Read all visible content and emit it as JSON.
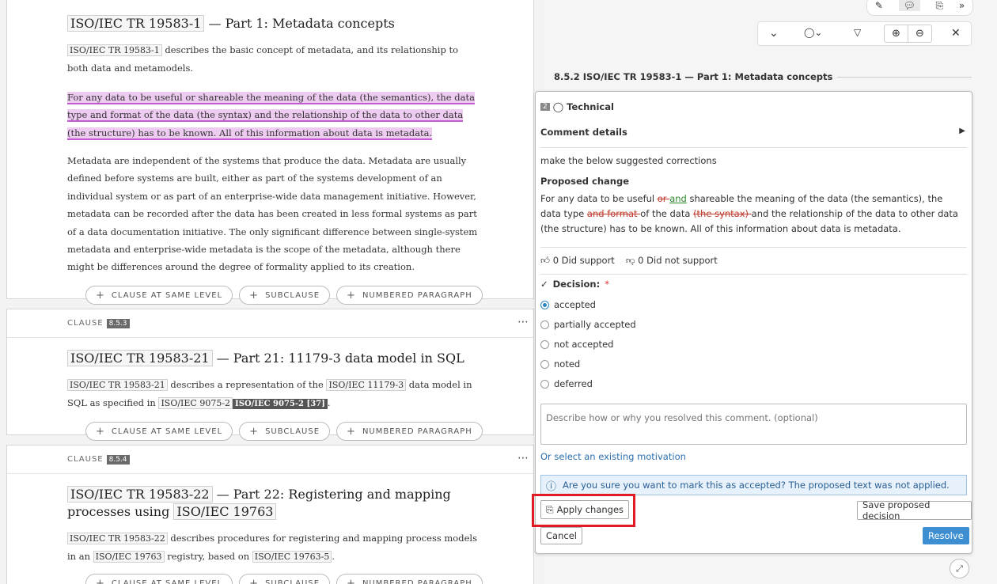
{
  "clause_852": {
    "title_ref": "ISO/IEC TR 19583-1",
    "title_rest": " — Part 1: Metadata concepts",
    "p1_ref": "ISO/IEC TR 19583-1",
    "p1_rest": " describes the basic concept of metadata, and its relationship to both data and metamodels.",
    "p2_highlight": "For any data to be useful or shareable the meaning of the data (the semantics), the data type and format of the data (the syntax) and the relationship of the data to other data (the structure) has to be known. All of this information about data is metadata.",
    "p3": "Metadata are independent of the systems that produce the data. Metadata are usually defined before systems are built, either as part of the systems development of an individual system or as part of an enterprise-wide data management initiative. However, metadata can be recorded after the data has been created in less formal systems as part of a data documentation initiative. The only significant difference between single-system metadata and enterprise-wide metadata is the scope of the metadata, although there might be differences around the degree of formality applied to its creation."
  },
  "add_buttons": {
    "same_level": "CLAUSE AT SAME LEVEL",
    "subclause": "SUBCLAUSE",
    "numbered_paragraph": "NUMBERED PARAGRAPH"
  },
  "clause_853": {
    "label": "CLAUSE",
    "num": "8.5.3",
    "title_ref": "ISO/IEC TR 19583-21",
    "title_rest": " — Part 21: 11179-3 data model in SQL",
    "p_ref1": "ISO/IEC TR 19583-21",
    "p_mid1": " describes a representation of the ",
    "p_ref2": "ISO/IEC 11179-3",
    "p_mid2": " data model in SQL as specified in ",
    "p_ref3": "ISO/IEC 9075-2",
    "p_ref4": "ISO/IEC 9075-2 [37]",
    "p_end": "."
  },
  "clause_854": {
    "label": "CLAUSE",
    "num": "8.5.4",
    "title_ref1": "ISO/IEC TR 19583-22",
    "title_mid": " — Part 22: Registering and mapping processes using ",
    "title_ref2": "ISO/IEC 19763",
    "p_ref1": "ISO/IEC TR 19583-22",
    "p_mid1": " describes procedures for registering and mapping process models in an ",
    "p_ref2": "ISO/IEC 19763",
    "p_mid2": " registry, based on ",
    "p_ref3": "ISO/IEC 19763-5",
    "p_end": "."
  },
  "right_panel": {
    "section_heading": "8.5.2 ISO/IEC TR 19583-1 — Part 1: Metadata concepts"
  },
  "comment": {
    "number": "2",
    "type": "Technical",
    "details_label": "Comment details",
    "body": "make the below suggested corrections",
    "proposed_label": "Proposed change",
    "pc": {
      "t1": "For any data to be useful ",
      "d1": "or ",
      "i1": "and",
      "t2": " shareable the meaning of the data (the semantics), the data type ",
      "d2": "and format ",
      "t3": "of the data ",
      "d3": "(the syntax) ",
      "t4": " and the relationship of the data to other data (the structure) has to be known. All of this information about data is metadata."
    },
    "support": "0 Did support",
    "not_support": "0 Did not support",
    "decision_label": "Decision:",
    "required_mark": "*",
    "options": [
      "accepted",
      "partially accepted",
      "not accepted",
      "noted",
      "deferred"
    ],
    "selected": "accepted",
    "motivation_placeholder": "Describe how or why you resolved this comment. (optional)",
    "select_motivation": "Or select an existing motivation",
    "info_text": "Are you sure you want to mark this as accepted? The proposed text was not applied.",
    "apply_label": "Apply changes",
    "save_label": "Save proposed decision",
    "cancel_label": "Cancel",
    "resolve_label": "Resolve"
  },
  "colors": {
    "accent": "#3d8fd1",
    "highlight": "#eecbf1",
    "callout": "#e01b24"
  }
}
